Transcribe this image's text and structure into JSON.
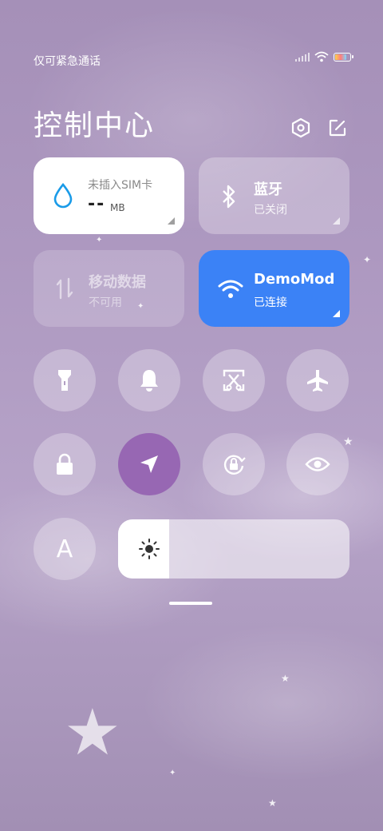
{
  "status": {
    "carrier": "仅可紧急通话"
  },
  "title": "控制中心",
  "tiles": {
    "data": {
      "label": "未插入SIM卡",
      "value": "--",
      "unit": "MB"
    },
    "bluetooth": {
      "name": "蓝牙",
      "status": "已关闭"
    },
    "mobile": {
      "name": "移动数据",
      "status": "不可用"
    },
    "wifi": {
      "name": "DemoMod",
      "status": "已连接"
    }
  },
  "toggles": [
    {
      "icon": "flashlight-icon",
      "active": false
    },
    {
      "icon": "bell-icon",
      "active": false
    },
    {
      "icon": "screenshot-icon",
      "active": false
    },
    {
      "icon": "airplane-icon",
      "active": false
    },
    {
      "icon": "lock-icon",
      "active": false
    },
    {
      "icon": "location-icon",
      "active": true
    },
    {
      "icon": "rotation-lock-icon",
      "active": false
    },
    {
      "icon": "eye-icon",
      "active": false
    },
    {
      "icon": "font-icon",
      "active": false
    }
  ],
  "font_toggle_label": "A",
  "brightness": {
    "level": 0.22
  },
  "colors": {
    "accent": "#3b82f6",
    "active_round": "#9767b3"
  }
}
